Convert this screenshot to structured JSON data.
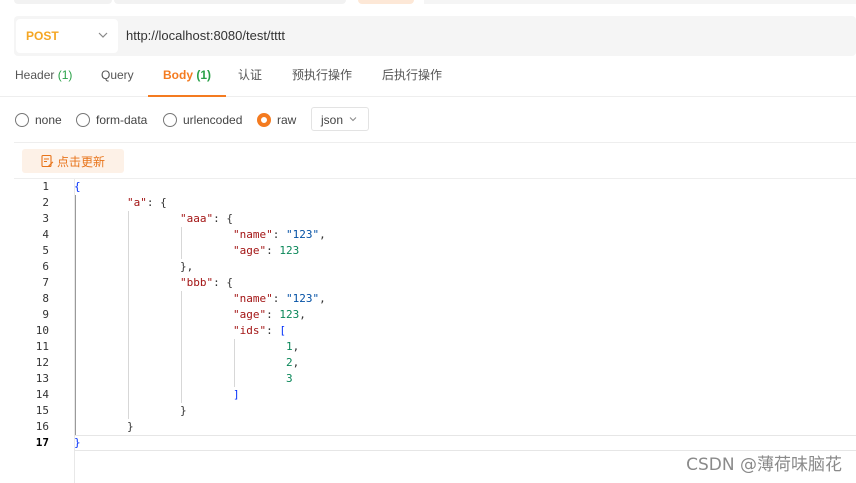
{
  "request": {
    "method": "POST",
    "url": "http://localhost:8080/test/tttt"
  },
  "tabs": [
    {
      "label": "Header",
      "count": "(1)"
    },
    {
      "label": "Query",
      "count": ""
    },
    {
      "label": "Body",
      "count": "(1)"
    },
    {
      "label": "认证",
      "count": ""
    },
    {
      "label": "预执行操作",
      "count": ""
    },
    {
      "label": "后执行操作",
      "count": ""
    }
  ],
  "active_tab": "Body",
  "body_types": {
    "none": "none",
    "form_data": "form-data",
    "urlencoded": "urlencoded",
    "raw": "raw",
    "selected": "raw",
    "format": "json"
  },
  "refresh_button": "点击更新",
  "editor": {
    "line_numbers": [
      "1",
      "2",
      "3",
      "4",
      "5",
      "6",
      "7",
      "8",
      "9",
      "10",
      "11",
      "12",
      "13",
      "14",
      "15",
      "16",
      "17"
    ],
    "current_line": "17",
    "tokens": {
      "l1_open": "{",
      "l2_key": "\"a\"",
      "l2_rest": ": {",
      "l3_key": "\"aaa\"",
      "l3_rest": ": {",
      "l4_key": "\"name\"",
      "l4_colon": ": ",
      "l4_val": "\"123\"",
      "l4_comma": ",",
      "l5_key": "\"age\"",
      "l5_colon": ": ",
      "l5_val": "123",
      "l6_close": "},",
      "l7_key": "\"bbb\"",
      "l7_rest": ": {",
      "l8_key": "\"name\"",
      "l8_colon": ": ",
      "l8_val": "\"123\"",
      "l8_comma": ",",
      "l9_key": "\"age\"",
      "l9_colon": ": ",
      "l9_val": "123",
      "l9_comma": ",",
      "l10_key": "\"ids\"",
      "l10_colon": ": ",
      "l10_bracket": "[",
      "l11_val": "1",
      "l11_comma": ",",
      "l12_val": "2",
      "l12_comma": ",",
      "l13_val": "3",
      "l14_close": "]",
      "l15_close": "}",
      "l16_close": "}",
      "l17_close": "}"
    }
  },
  "watermark": "CSDN @薄荷味脑花",
  "colors": {
    "accent": "#f47b20",
    "method": "#f5a623",
    "count": "#2aa148",
    "json_key": "#a31515",
    "json_string": "#0451a5",
    "json_number": "#098658"
  },
  "icons": {
    "method_dropdown": "chevron-down-icon",
    "format_dropdown": "chevron-down-icon",
    "refresh": "edit-note-icon"
  }
}
